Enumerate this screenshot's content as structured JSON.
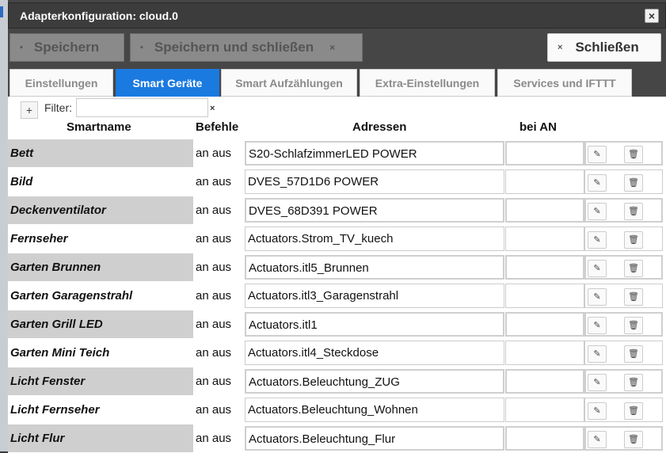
{
  "window": {
    "title": "Adapterkonfiguration: cloud.0"
  },
  "icons": {
    "close": "×",
    "save": "▪",
    "remove": "×",
    "plus": "+",
    "edit": "✎",
    "delete": "🗑"
  },
  "toolbar": {
    "save_label": "Speichern",
    "save_close_label": "Speichern und schließen",
    "close_label": "Schließen"
  },
  "tabs": [
    {
      "label": "Einstellungen"
    },
    {
      "label": "Smart Geräte"
    },
    {
      "label": "Smart Aufzählungen"
    },
    {
      "label": "Extra-Einstellungen"
    },
    {
      "label": "Services und IFTTT"
    }
  ],
  "filter": {
    "label": "Filter:",
    "value": ""
  },
  "table": {
    "headers": {
      "name": "Smartname",
      "commands": "Befehle",
      "addresses": "Adressen",
      "on_value": "bei AN"
    },
    "rows": [
      {
        "name": "Bett",
        "cmd": "an aus",
        "addr": "S20-SchlafzimmerLED POWER"
      },
      {
        "name": "Bild",
        "cmd": "an aus",
        "addr": "DVES_57D1D6 POWER"
      },
      {
        "name": "Deckenventilator",
        "cmd": "an aus",
        "addr": "DVES_68D391 POWER"
      },
      {
        "name": "Fernseher",
        "cmd": "an aus",
        "addr": "Actuators.Strom_TV_kuech"
      },
      {
        "name": "Garten Brunnen",
        "cmd": "an aus",
        "addr": "Actuators.itl5_Brunnen"
      },
      {
        "name": "Garten Garagenstrahl",
        "cmd": "an aus",
        "addr": "Actuators.itl3_Garagenstrahl"
      },
      {
        "name": "Garten Grill LED",
        "cmd": "an aus",
        "addr": "Actuators.itl1"
      },
      {
        "name": "Garten Mini Teich",
        "cmd": "an aus",
        "addr": "Actuators.itl4_Steckdose"
      },
      {
        "name": "Licht Fenster",
        "cmd": "an aus",
        "addr": "Actuators.Beleuchtung_ZUG"
      },
      {
        "name": "Licht Fernseher",
        "cmd": "an aus",
        "addr": "Actuators.Beleuchtung_Wohnen"
      },
      {
        "name": "Licht Flur",
        "cmd": "an aus",
        "addr": "Actuators.Beleuchtung_Flur"
      }
    ]
  }
}
